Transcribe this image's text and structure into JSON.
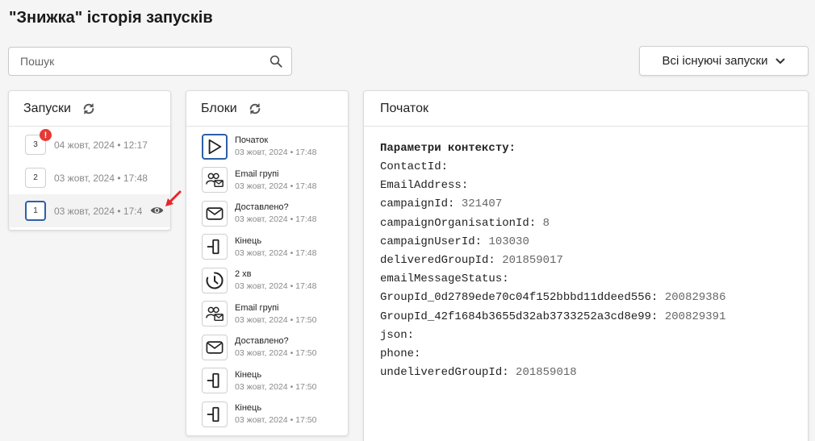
{
  "page": {
    "title": "\"Знижка\" історія запусків"
  },
  "search": {
    "placeholder": "Пошук"
  },
  "filter": {
    "label": "Всі існуючі запуски"
  },
  "runs_panel": {
    "title": "Запуски",
    "items": [
      {
        "number": "3",
        "date": "04 жовт, 2024 • 12:17",
        "alert": "!"
      },
      {
        "number": "2",
        "date": "03 жовт, 2024 • 17:48"
      },
      {
        "number": "1",
        "date": "03 жовт, 2024 • 17:4",
        "active": true
      }
    ]
  },
  "blocks_panel": {
    "title": "Блоки",
    "items": [
      {
        "name": "Початок",
        "date": "03 жовт, 2024 • 17:48",
        "icon": "play-icon"
      },
      {
        "name": "Email групі",
        "date": "03 жовт, 2024 • 17:48",
        "icon": "group-email-icon"
      },
      {
        "name": "Доставлено?",
        "date": "03 жовт, 2024 • 17:48",
        "icon": "envelope-icon"
      },
      {
        "name": "Кінець",
        "date": "03 жовт, 2024 • 17:48",
        "icon": "end-icon"
      },
      {
        "name": "2 хв",
        "date": "03 жовт, 2024 • 17:48",
        "icon": "timer-icon"
      },
      {
        "name": "Email групі",
        "date": "03 жовт, 2024 • 17:50",
        "icon": "group-email-icon"
      },
      {
        "name": "Доставлено?",
        "date": "03 жовт, 2024 • 17:50",
        "icon": "envelope-icon"
      },
      {
        "name": "Кінець",
        "date": "03 жовт, 2024 • 17:50",
        "icon": "end-icon"
      },
      {
        "name": "Кінець",
        "date": "03 жовт, 2024 • 17:50",
        "icon": "end-icon"
      }
    ]
  },
  "details_panel": {
    "title": "Початок",
    "context_title": "Параметри контексту:",
    "params": [
      {
        "key": "ContactId:",
        "value": ""
      },
      {
        "key": "EmailAddress:",
        "value": ""
      },
      {
        "key": "campaignId:",
        "value": "321407"
      },
      {
        "key": "campaignOrganisationId:",
        "value": "8"
      },
      {
        "key": "campaignUserId:",
        "value": "103030"
      },
      {
        "key": "deliveredGroupId:",
        "value": "201859017"
      },
      {
        "key": "emailMessageStatus:",
        "value": ""
      },
      {
        "key": "GroupId_0d2789ede70c04f152bbbd11ddeed556:",
        "value": "200829386"
      },
      {
        "key": "GroupId_42f1684b3655d32ab3733252a3cd8e99:",
        "value": "200829391"
      },
      {
        "key": "json:",
        "value": ""
      },
      {
        "key": "phone:",
        "value": ""
      },
      {
        "key": "undeliveredGroupId:",
        "value": "201859018"
      }
    ]
  },
  "colors": {
    "accent": "#2d5fa6",
    "alert": "#e53935",
    "annotation_arrow": "#e8262a"
  }
}
